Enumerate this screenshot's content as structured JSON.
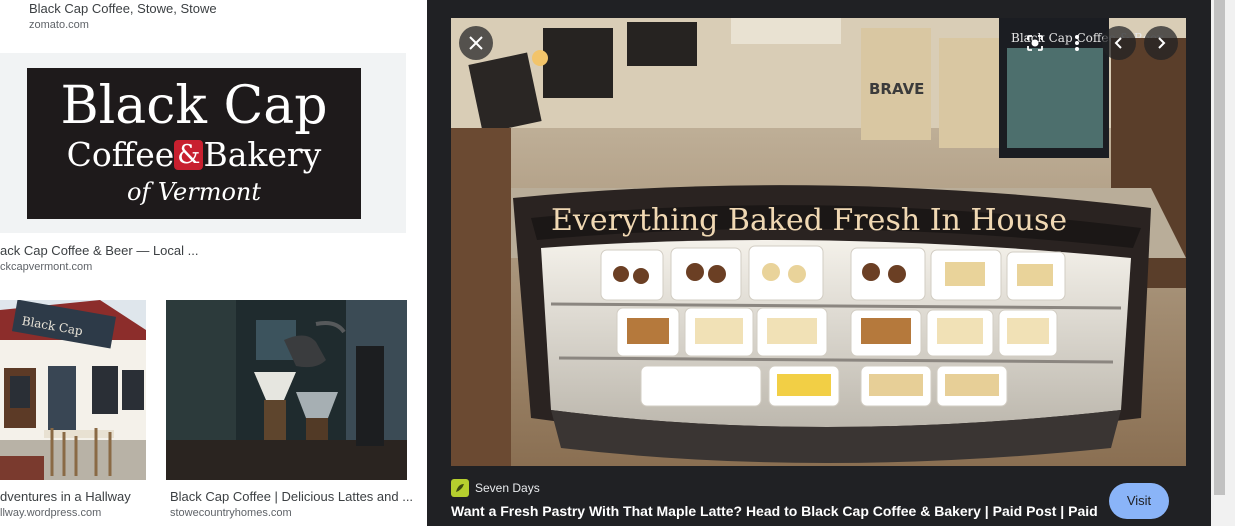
{
  "results": {
    "top": {
      "title": "Black Cap Coffee, Stowe, Stowe",
      "source": "zomato.com"
    },
    "logo": {
      "title": "ack Cap Coffee & Beer — Local ...",
      "source": "ckcapvermont.com",
      "logo_line1": "Black Cap",
      "logo_coffee": "Coffee",
      "logo_amp": "&",
      "logo_bakery": "Bakery",
      "logo_line3": "of Vermont"
    },
    "cafe": {
      "title": "dventures in a Hallway",
      "source": "llway.wordpress.com",
      "sign": "Black Cap"
    },
    "pour": {
      "title": "Black Cap Coffee | Delicious Lattes and ...",
      "source": "stowecountryhomes.com"
    }
  },
  "viewer": {
    "photo": {
      "banner": "Everything Baked Fresh In House",
      "bag_label": "BRAVE",
      "sign": "Black Cap Coffee & Beer"
    },
    "source_name": "Seven Days",
    "title": "Want a Fresh Pastry With That Maple Latte? Head to Black Cap Coffee & Bakery | Paid Post | Paid",
    "visit_label": "Visit",
    "icons": [
      "close-icon",
      "lens-icon",
      "more-vert-icon",
      "chevron-left-icon",
      "chevron-right-icon"
    ]
  },
  "colors": {
    "panel_bg": "#202124",
    "visit_bg": "#8ab4f8",
    "logo_bg": "#1e1a1b",
    "logo_accent": "#c8202f",
    "favicon": "#b6cf2e"
  }
}
